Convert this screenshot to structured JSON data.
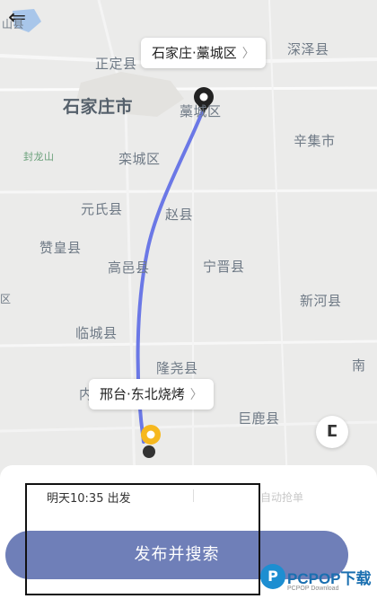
{
  "map": {
    "places": [
      {
        "name": "石家庄市",
        "cls": "big"
      },
      {
        "name": "正定县"
      },
      {
        "name": "藁城区"
      },
      {
        "name": "深泽县"
      },
      {
        "name": "辛集市"
      },
      {
        "name": "封龙山",
        "cls": "green"
      },
      {
        "name": "栾城区"
      },
      {
        "name": "元氏县"
      },
      {
        "name": "赵县"
      },
      {
        "name": "赞皇县"
      },
      {
        "name": "高邑县"
      },
      {
        "name": "宁晋县"
      },
      {
        "name": "新河县"
      },
      {
        "name": "临城县"
      },
      {
        "name": "隆尧县"
      },
      {
        "name": "巨鹿县"
      },
      {
        "name": "南"
      },
      {
        "name": "内"
      },
      {
        "name": "山县",
        "cls": "small"
      },
      {
        "name": "区",
        "cls": "small"
      }
    ],
    "origin_callout": "石家庄·藁城区",
    "destination_callout": "邢台·东北烧烤",
    "route_color": "#6b78e6",
    "locate_icon": "relocate-icon"
  },
  "sheet": {
    "depart_text": "明天10:35 出发",
    "auto_grab_text": "自动抢单",
    "publish_label": "发布并搜索",
    "publish_color": "#6f7fb8"
  },
  "watermark": {
    "logo_letter": "P",
    "brand": "PCPOP下载",
    "sub": "PCPOP Download"
  }
}
